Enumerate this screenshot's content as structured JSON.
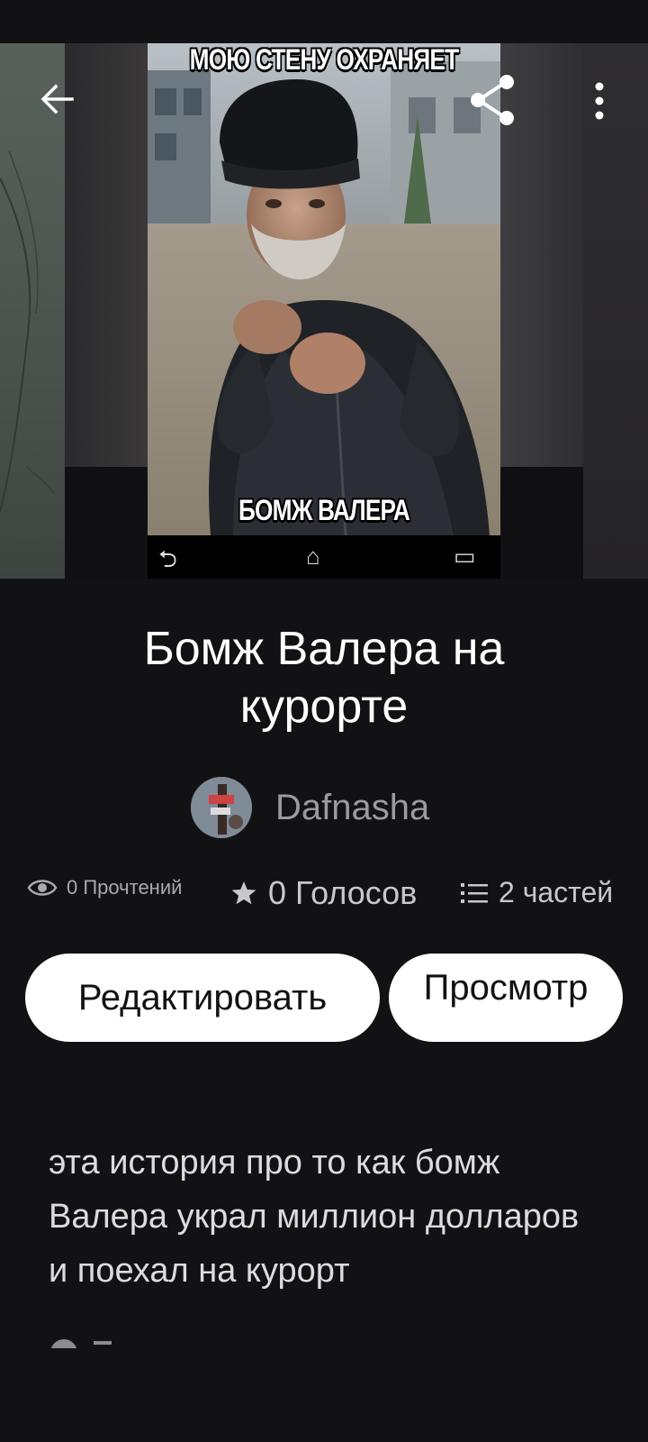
{
  "cover": {
    "top_caption": "МОЮ СТЕНУ ОХРАНЯЕТ",
    "bottom_caption": "БОМЖ ВАЛЕРА"
  },
  "toolbar": {
    "back_icon": "arrow-left-icon",
    "share_icon": "share-icon",
    "more_icon": "more-vertical-icon"
  },
  "story": {
    "title": "Бомж Валера на курорте",
    "author": "Dafnasha",
    "description": "эта история про то как бомж Валера украл миллион долларов и поехал на курорт"
  },
  "stats": {
    "reads": "0 Прочтений",
    "votes": "0 Голосов",
    "parts": "2 частей",
    "reads_icon": "eye-icon",
    "votes_icon": "star-icon",
    "parts_icon": "list-icon"
  },
  "actions": {
    "edit_label": "Редактировать",
    "view_label": "Просмотр"
  },
  "colors": {
    "background": "#121114",
    "button_bg": "#ffffff",
    "secondary_text": "#9a9aa0"
  }
}
